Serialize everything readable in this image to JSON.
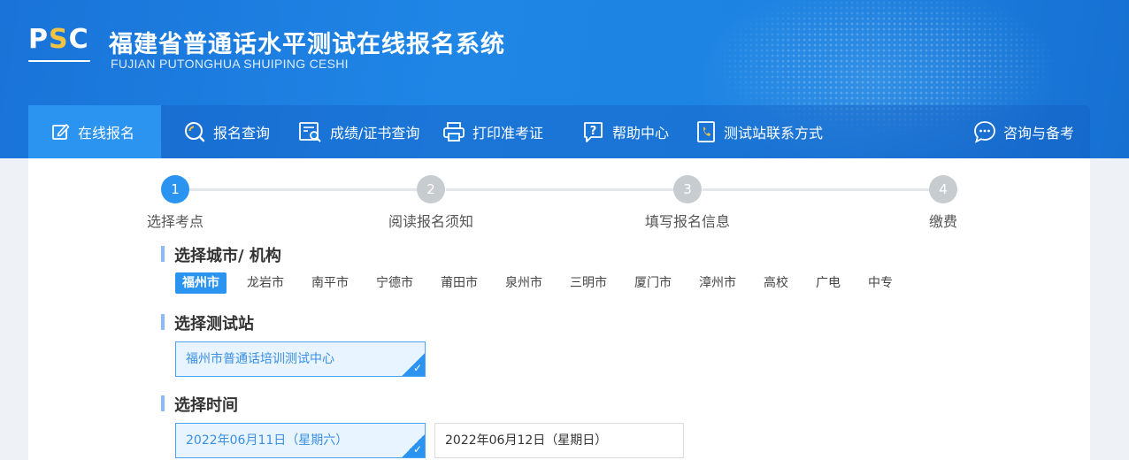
{
  "header": {
    "logo": {
      "part1": "P",
      "part2": "S",
      "part3": "C"
    },
    "title": "福建省普通话水平测试在线报名系统",
    "subtitle": "FUJIAN PUTONGHUA SHUIPING CESHI"
  },
  "nav": {
    "items": [
      {
        "label": "在线报名",
        "icon": "edit-icon",
        "active": true
      },
      {
        "label": "报名查询",
        "icon": "search-icon",
        "active": false
      },
      {
        "label": "成绩/证书查询",
        "icon": "certificate-search-icon",
        "active": false
      },
      {
        "label": "打印准考证",
        "icon": "printer-icon",
        "active": false
      },
      {
        "label": "帮助中心",
        "icon": "help-icon",
        "active": false
      },
      {
        "label": "测试站联系方式",
        "icon": "phone-book-icon",
        "active": false
      },
      {
        "label": "咨询与备考",
        "icon": "chat-icon",
        "active": false
      }
    ]
  },
  "steps": [
    {
      "number": "1",
      "label": "选择考点",
      "active": true
    },
    {
      "number": "2",
      "label": "阅读报名须知",
      "active": false
    },
    {
      "number": "3",
      "label": "填写报名信息",
      "active": false
    },
    {
      "number": "4",
      "label": "缴费",
      "active": false
    }
  ],
  "city_section": {
    "title": "选择城市/ 机构",
    "items": [
      "福州市",
      "龙岩市",
      "南平市",
      "宁德市",
      "莆田市",
      "泉州市",
      "三明市",
      "厦门市",
      "漳州市",
      "高校",
      "广电",
      "中专"
    ],
    "selected": "福州市"
  },
  "station_section": {
    "title": "选择测试站",
    "options": [
      {
        "label": "福州市普通话培训测试中心",
        "selected": true
      }
    ]
  },
  "time_section": {
    "title": "选择时间",
    "options": [
      {
        "label": "2022年06月11日（星期六）",
        "selected": true
      },
      {
        "label": "2022年06月12日（星期日）",
        "selected": false
      }
    ]
  },
  "colors": {
    "primary": "#2b93f0",
    "header_blue": "#1d83e2",
    "selected_bg": "#e8f4ff",
    "inactive_step": "#c7ccd1",
    "section_bar": "#8fbaf0"
  }
}
